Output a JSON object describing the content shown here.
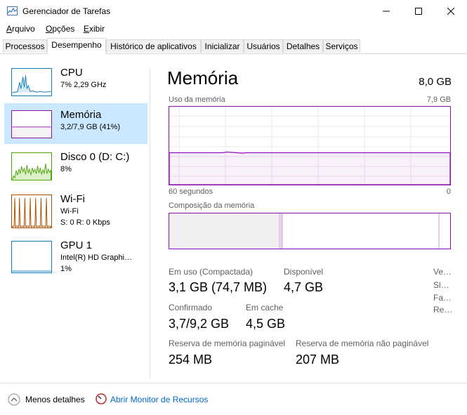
{
  "window": {
    "title": "Gerenciador de Tarefas",
    "minimize_icon": "minimize-icon",
    "maximize_icon": "maximize-icon",
    "close_icon": "close-icon"
  },
  "menu": {
    "file_rest": "rquivo",
    "file_key": "A",
    "options_key": "O",
    "options_rest": "pções",
    "view_rest": "xibir",
    "view_key": "E"
  },
  "tabs": [
    {
      "label": "Processos"
    },
    {
      "label": "Desempenho"
    },
    {
      "label": "Histórico de aplicativos"
    },
    {
      "label": "Inicializar"
    },
    {
      "label": "Usuários"
    },
    {
      "label": "Detalhes"
    },
    {
      "label": "Serviços"
    }
  ],
  "sidebar": {
    "items": [
      {
        "title": "CPU",
        "line1": "7% 2,29 GHz",
        "line2": "",
        "color": "#117dbb"
      },
      {
        "title": "Memória",
        "line1": "3,2/7,9 GB (41%)",
        "line2": "",
        "color": "#8b12ae"
      },
      {
        "title": "Disco 0 (D: C:)",
        "line1": "8%",
        "line2": "",
        "color": "#4da60c"
      },
      {
        "title": "Wi-Fi",
        "line1": "Wi-Fi",
        "line2": "S: 0 R: 0 Kbps",
        "color": "#a74f01"
      },
      {
        "title": "GPU 1",
        "line1": "Intel(R) HD Graphi…",
        "line2": "1%",
        "color": "#117dbb"
      }
    ]
  },
  "main": {
    "title": "Memória",
    "total": "8,0 GB",
    "usage_label": "Uso da memória",
    "usage_max": "7,9 GB",
    "time_label": "60 segundos",
    "time_zero": "0",
    "composition_label": "Composição da memória",
    "usage_fraction": 0.41,
    "stats": {
      "in_use_label": "Em uso (Compactada)",
      "in_use_value": "3,1 GB (74,7 MB)",
      "available_label": "Disponível",
      "available_value": "4,7 GB",
      "committed_label": "Confirmado",
      "committed_value": "3,7/9,2 GB",
      "cached_label": "Em cache",
      "cached_value": "4,5 GB",
      "paged_label": "Reserva de memória paginável",
      "paged_value": "254 MB",
      "nonpaged_label": "Reserva de memória não paginável",
      "nonpaged_value": "207 MB"
    },
    "right_labels": [
      "Ve…",
      "Sl…",
      "Fa…",
      "Re…"
    ]
  },
  "footer": {
    "less_details": "Menos detalhes",
    "resource_monitor": "Abrir Monitor de Recursos"
  },
  "colors": {
    "memory": "#8b12ae",
    "selected": "#cce8ff",
    "link": "#0066cc"
  }
}
